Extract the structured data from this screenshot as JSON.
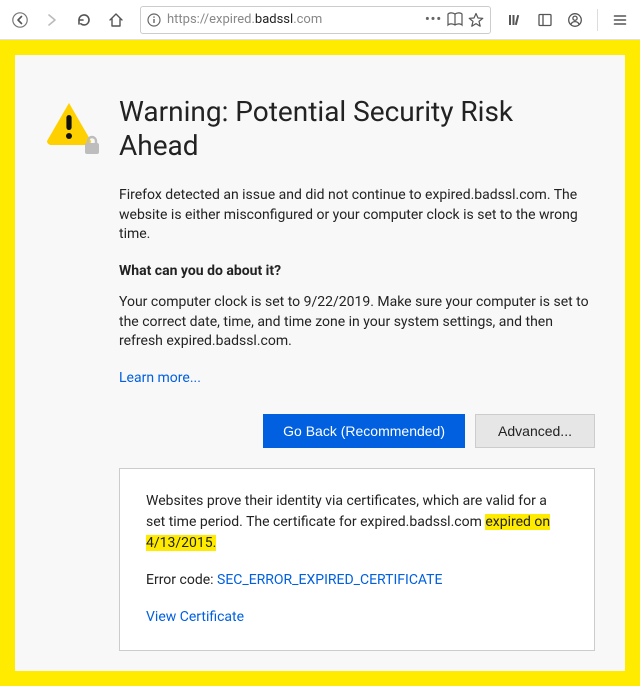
{
  "toolbar": {
    "url_scheme": "https://",
    "url_host": "expired.",
    "url_domain": "badssl",
    "url_tld": ".com"
  },
  "page": {
    "title": "Warning: Potential Security Risk Ahead",
    "intro": "Firefox detected an issue and did not continue to expired.badssl.com. The website is either misconfigured or your computer clock is set to the wrong time.",
    "subhead": "What can you do about it?",
    "clock_msg": "Your computer clock is set to 9/22/2019. Make sure your computer is set to the correct date, time, and time zone in your system settings, and then refresh expired.badssl.com.",
    "learn_more": "Learn more...",
    "go_back": "Go Back (Recommended)",
    "advanced": "Advanced...",
    "details_pre": "Websites prove their identity via certificates, which are valid for a set time period. The certificate for expired.badssl.com ",
    "details_highlight": "expired on 4/13/2015.",
    "error_label": "Error code: ",
    "error_code": "SEC_ERROR_EXPIRED_CERTIFICATE",
    "view_cert": "View Certificate"
  }
}
